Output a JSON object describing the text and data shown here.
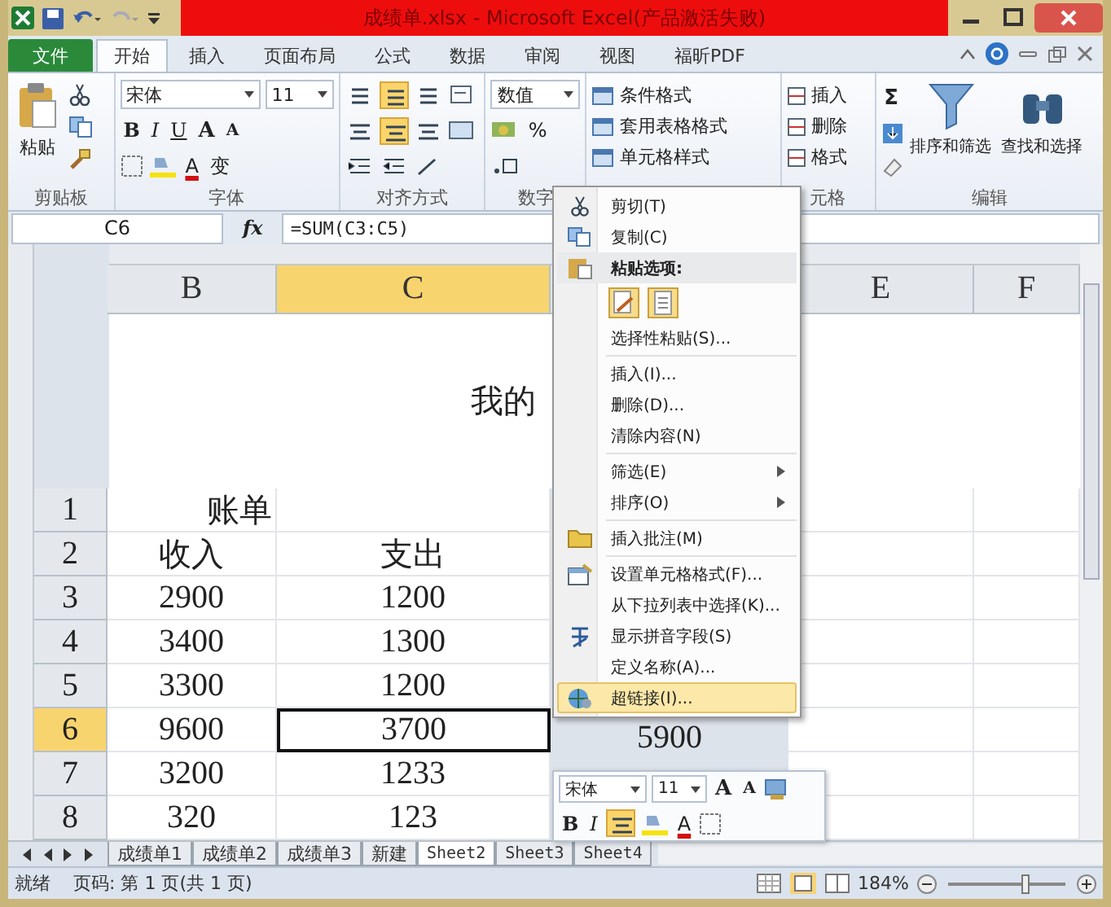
{
  "window": {
    "title": "成绩单.xlsx - Microsoft Excel(产品激活失败)"
  },
  "ribbon_tabs": [
    {
      "label": "文件",
      "kind": "file",
      "selected": false
    },
    {
      "label": "开始",
      "kind": "tab",
      "selected": true
    },
    {
      "label": "插入",
      "kind": "tab",
      "selected": false
    },
    {
      "label": "页面布局",
      "kind": "tab",
      "selected": false
    },
    {
      "label": "公式",
      "kind": "tab",
      "selected": false
    },
    {
      "label": "数据",
      "kind": "tab",
      "selected": false
    },
    {
      "label": "审阅",
      "kind": "tab",
      "selected": false
    },
    {
      "label": "视图",
      "kind": "tab",
      "selected": false
    },
    {
      "label": "福昕PDF",
      "kind": "tab",
      "selected": false
    }
  ],
  "clipboard": {
    "paste": "粘贴",
    "label": "剪贴板"
  },
  "font": {
    "name": "宋体",
    "size": "11",
    "bold": "B",
    "italic": "I",
    "underline": "U",
    "grow": "A",
    "shrink": "A",
    "color_button": "A",
    "phonetic": "变",
    "label": "字体"
  },
  "alignment": {
    "label": "对齐方式"
  },
  "number": {
    "format": "数值",
    "percent": "%",
    "label": "数字"
  },
  "styles": [
    "条件格式",
    "套用表格格式",
    "单元格样式"
  ],
  "cells": {
    "items": [
      "插入",
      "删除",
      "格式"
    ],
    "label": "元格"
  },
  "editing": {
    "sum": "Σ",
    "items": [
      "排序和筛选",
      "查找和选择"
    ],
    "label": "编辑"
  },
  "formula_bar": {
    "name_box": "C6",
    "function_label": "fx",
    "formula": "=SUM(C3:C5)"
  },
  "page_header": "我的",
  "columns": [
    {
      "label": "B",
      "selected": false
    },
    {
      "label": "C",
      "selected": true
    },
    {
      "label": "E",
      "selected": false
    },
    {
      "label": "F",
      "selected": false
    }
  ],
  "rows": [
    {
      "number": "1",
      "selected": false,
      "b": "账单"
    },
    {
      "number": "2",
      "selected": false,
      "b": "收入",
      "c": "支出"
    },
    {
      "number": "3",
      "selected": false,
      "b": "2900",
      "c": "1200"
    },
    {
      "number": "4",
      "selected": false,
      "b": "3400",
      "c": "1300"
    },
    {
      "number": "5",
      "selected": false,
      "b": "3300",
      "c": "1200"
    },
    {
      "number": "6",
      "selected": true,
      "b": "9600",
      "c": "3700",
      "d": "5900"
    },
    {
      "number": "7",
      "selected": false,
      "b": "3200",
      "c": "1233"
    },
    {
      "number": "8",
      "selected": false,
      "b": "320",
      "c": "123"
    }
  ],
  "context_menu": {
    "items": [
      {
        "kind": "cut",
        "label": "剪切(T)",
        "selected": false,
        "submenu": false
      },
      {
        "kind": "copy",
        "label": "复制(C)",
        "selected": false,
        "submenu": false
      },
      {
        "kind": "paste_header",
        "label": "粘贴选项:"
      },
      {
        "kind": "paste_options"
      },
      {
        "kind": "command",
        "label": "选择性粘贴(S)...",
        "selected": false,
        "submenu": false
      },
      {
        "kind": "separator"
      },
      {
        "kind": "command",
        "label": "插入(I)...",
        "selected": false,
        "submenu": false
      },
      {
        "kind": "command",
        "label": "删除(D)...",
        "selected": false,
        "submenu": false
      },
      {
        "kind": "command",
        "label": "清除内容(N)",
        "selected": false,
        "submenu": false
      },
      {
        "kind": "separator"
      },
      {
        "kind": "command",
        "label": "筛选(E)",
        "selected": false,
        "submenu": true
      },
      {
        "kind": "command",
        "label": "排序(O)",
        "selected": false,
        "submenu": true
      },
      {
        "kind": "separator"
      },
      {
        "kind": "comment",
        "label": "插入批注(M)",
        "selected": false,
        "submenu": false
      },
      {
        "kind": "separator"
      },
      {
        "kind": "format_cells",
        "label": "设置单元格格式(F)...",
        "selected": false,
        "submenu": false
      },
      {
        "kind": "command",
        "label": "从下拉列表中选择(K)...",
        "selected": false,
        "submenu": false
      },
      {
        "kind": "phonetic",
        "label": "显示拼音字段(S)",
        "selected": false,
        "submenu": false
      },
      {
        "kind": "command",
        "label": "定义名称(A)...",
        "selected": false,
        "submenu": false
      },
      {
        "kind": "hyperlink",
        "label": "超链接(I)...",
        "selected": true,
        "submenu": false
      }
    ]
  },
  "mini_toolbar": {
    "font": "宋体",
    "size": "11",
    "grow": "A",
    "shrink": "A",
    "bold": "B",
    "italic": "I",
    "color_button": "A"
  },
  "sheet_tabs": [
    {
      "label": "成绩单1",
      "selected": false
    },
    {
      "label": "成绩单2",
      "selected": false
    },
    {
      "label": "成绩单3",
      "selected": false
    },
    {
      "label": "新建",
      "selected": false
    },
    {
      "label": "Sheet2",
      "selected": true
    },
    {
      "label": "Sheet3",
      "selected": false
    },
    {
      "label": "Sheet4",
      "selected": false
    }
  ],
  "status_bar": {
    "ready": "就绪",
    "page": "页码: 第 1 页(共 1 页)",
    "zoom": "184%",
    "zoom_slider": {
      "level": 0.65
    }
  }
}
